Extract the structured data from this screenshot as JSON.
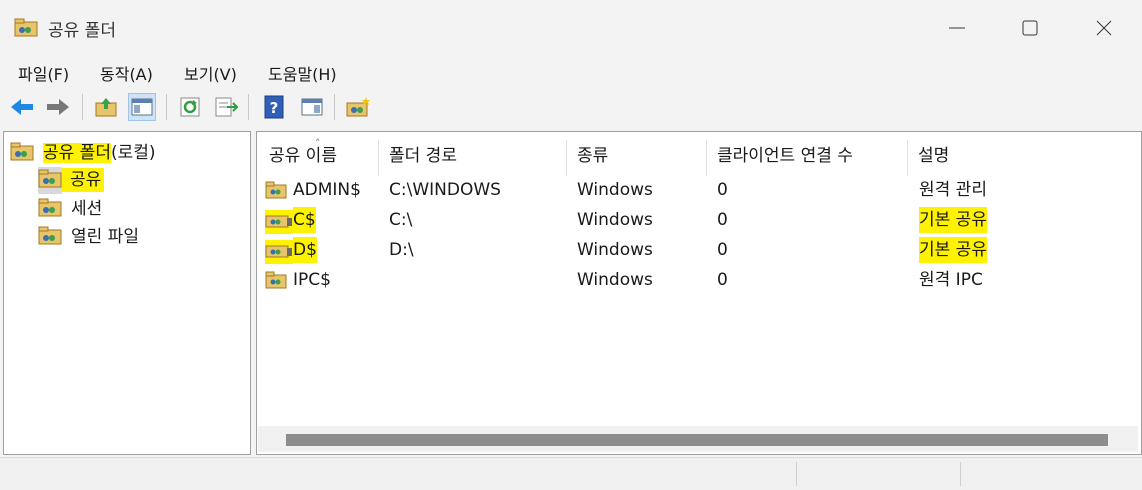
{
  "window": {
    "title": "공유 폴더",
    "icon": "shared-folder-icon"
  },
  "menu": [
    "파일(F)",
    "동작(A)",
    "보기(V)",
    "도움말(H)"
  ],
  "toolbar": {
    "icons": [
      "back-arrow-icon",
      "forward-arrow-icon",
      "up-folder-icon",
      "show-hide-tree-icon",
      "refresh-icon",
      "export-list-icon",
      "help-icon",
      "show-hide-action-pane-icon",
      "new-share-icon"
    ],
    "active": "show-hide-tree-icon"
  },
  "tree": {
    "root": {
      "label_highlighted": "공유 폴더",
      "label_suffix": "(로컬)"
    },
    "items": [
      {
        "label": "공유",
        "selected": true,
        "highlighted": true
      },
      {
        "label": "세션",
        "selected": false
      },
      {
        "label": "열린 파일",
        "selected": false
      }
    ]
  },
  "list": {
    "columns": [
      "공유 이름",
      "폴더 경로",
      "종류",
      "클라이언트 연결 수",
      "설명"
    ],
    "rows": [
      {
        "name": "ADMIN$",
        "path": "C:\\WINDOWS",
        "type": "Windows",
        "clients": "0",
        "description": "원격 관리",
        "highlight_name": false,
        "highlight_desc": false
      },
      {
        "name": "C$",
        "path": "C:\\",
        "type": "Windows",
        "clients": "0",
        "description": "기본 공유",
        "highlight_name": true,
        "highlight_desc": true
      },
      {
        "name": "D$",
        "path": "D:\\",
        "type": "Windows",
        "clients": "0",
        "description": "기본 공유",
        "highlight_name": true,
        "highlight_desc": true
      },
      {
        "name": "IPC$",
        "path": "",
        "type": "Windows",
        "clients": "0",
        "description": "원격 IPC",
        "highlight_name": false,
        "highlight_desc": false
      }
    ]
  },
  "colors": {
    "highlight": "#fff200",
    "selection": "#d9d9d9",
    "accent_blue": "#1e88e5"
  }
}
